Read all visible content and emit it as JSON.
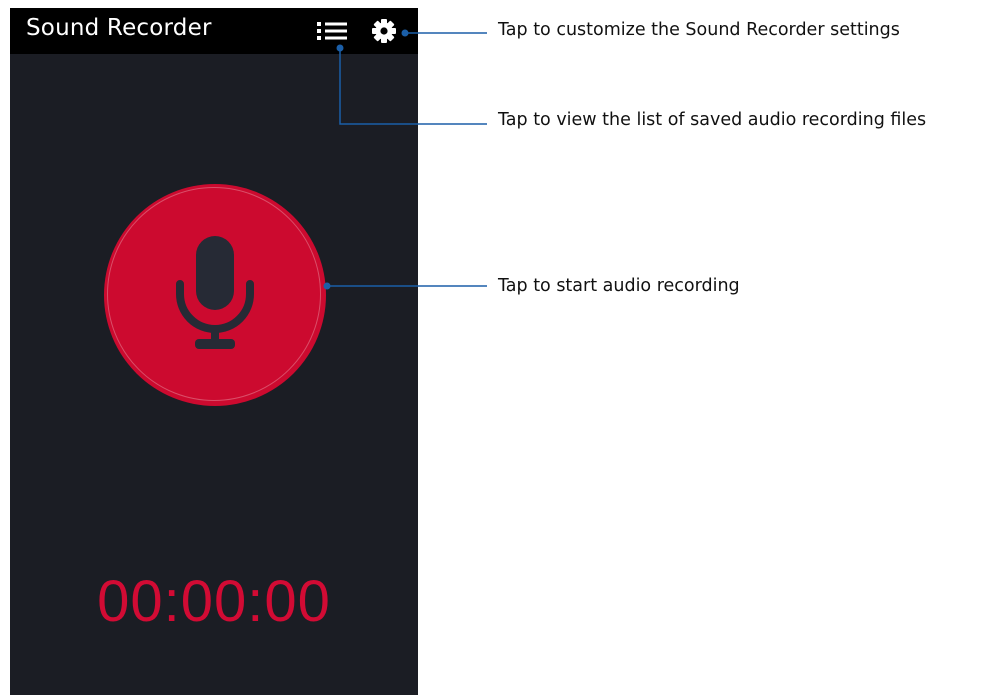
{
  "app": {
    "title": "Sound Recorder",
    "timer": "00:00:00"
  },
  "toolbar": {
    "list_icon": "list-icon",
    "settings_icon": "gear-icon"
  },
  "record_button": {
    "icon": "microphone-icon"
  },
  "callouts": {
    "settings": "Tap to customize the Sound Recorder settings",
    "list": "Tap to view the list of saved audio recording files",
    "record": "Tap to start audio recording"
  },
  "colors": {
    "appbar": "#000000",
    "background": "#1b1d24",
    "record_red": "#cc0a2f",
    "timer_red": "#d20b34",
    "callout_line": "#1b5fa8"
  }
}
